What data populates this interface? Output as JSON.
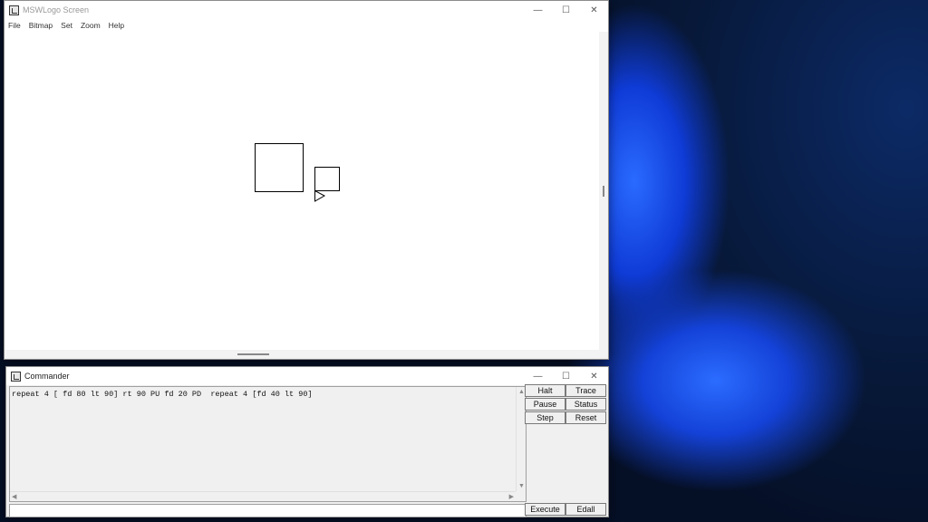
{
  "screen_window": {
    "title": "MSWLogo Screen",
    "menu": [
      "File",
      "Bitmap",
      "Set",
      "Zoom",
      "Help"
    ]
  },
  "commander": {
    "title": "Commander",
    "history_line": "repeat 4 [ fd 80 lt 90] rt 90 PU fd 20 PD  repeat 4 [fd 40 lt 90]",
    "input_value": "",
    "buttons": {
      "halt": "Halt",
      "trace": "Trace",
      "pause": "Pause",
      "status": "Status",
      "step": "Step",
      "reset": "Reset",
      "execute": "Execute",
      "edall": "Edall"
    }
  },
  "window_controls": {
    "minimize": "—",
    "maximize": "☐",
    "close": "✕"
  }
}
